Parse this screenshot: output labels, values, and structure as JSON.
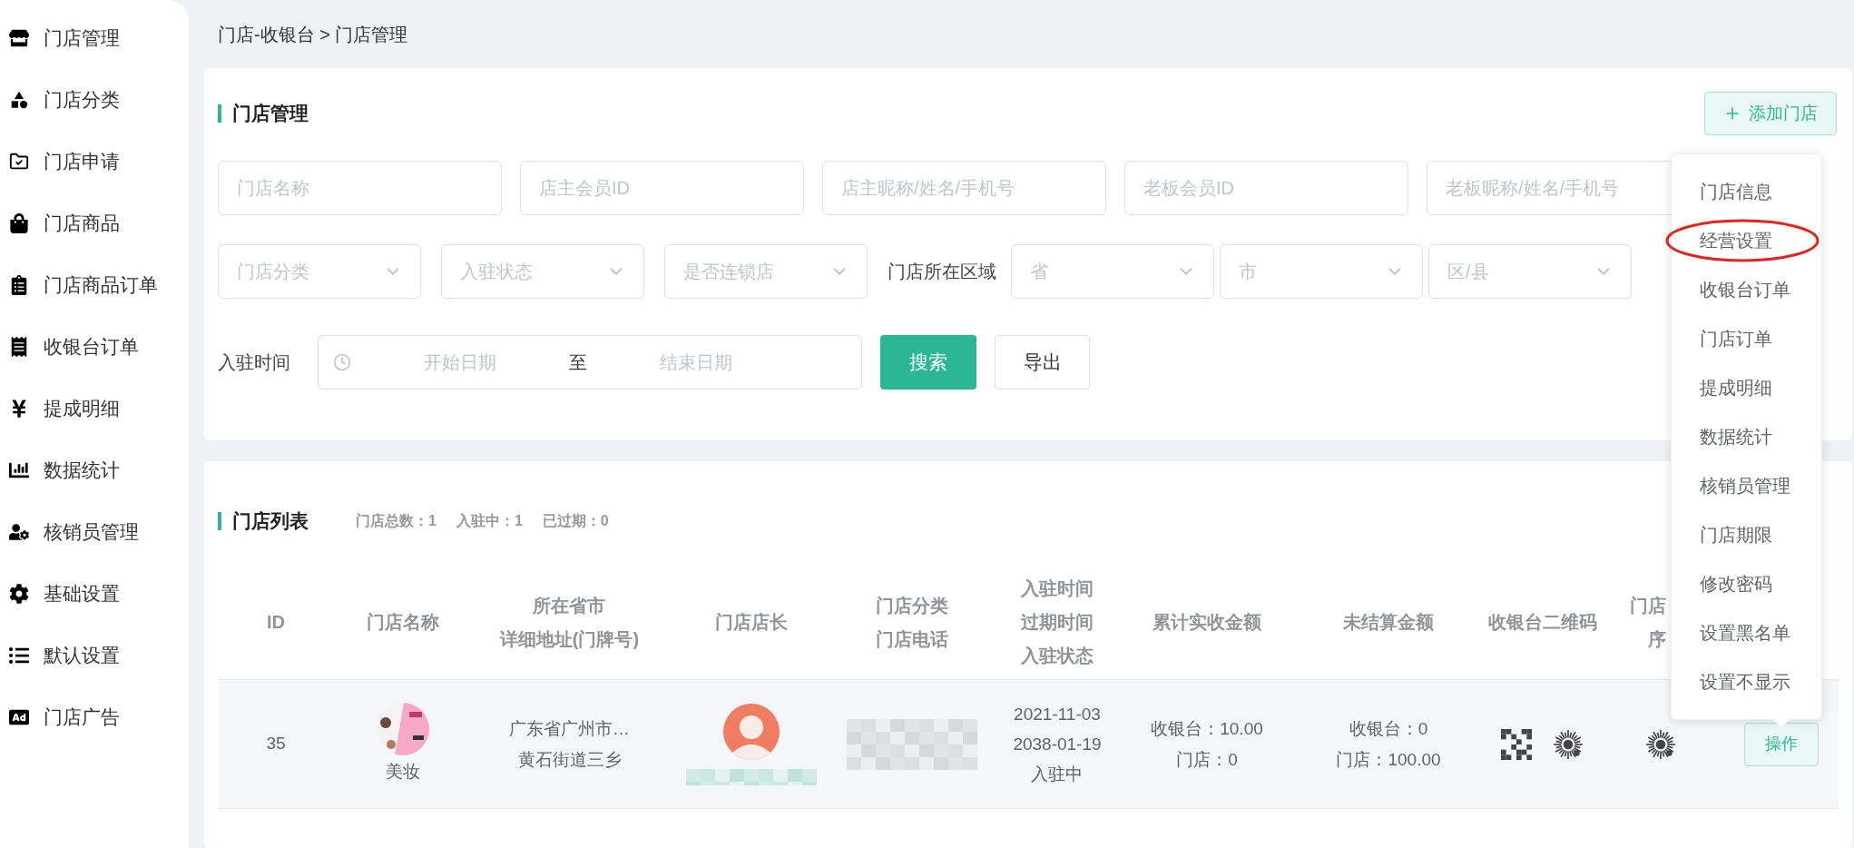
{
  "sidebar": {
    "items": [
      {
        "label": "门店管理"
      },
      {
        "label": "门店分类"
      },
      {
        "label": "门店申请"
      },
      {
        "label": "门店商品"
      },
      {
        "label": "门店商品订单"
      },
      {
        "label": "收银台订单"
      },
      {
        "label": "提成明细"
      },
      {
        "label": "数据统计"
      },
      {
        "label": "核销员管理"
      },
      {
        "label": "基础设置"
      },
      {
        "label": "默认设置"
      },
      {
        "label": "门店广告"
      }
    ]
  },
  "breadcrumb": "门店-收银台 > 门店管理",
  "filter_panel": {
    "title": "门店管理",
    "add_button": "添加门店",
    "text_fields": [
      {
        "placeholder": "门店名称"
      },
      {
        "placeholder": "店主会员ID"
      },
      {
        "placeholder": "店主昵称/姓名/手机号"
      },
      {
        "placeholder": "老板会员ID"
      },
      {
        "placeholder": "老板昵称/姓名/手机号"
      }
    ],
    "selects": [
      {
        "placeholder": "门店分类"
      },
      {
        "placeholder": "入驻状态"
      },
      {
        "placeholder": "是否连锁店"
      }
    ],
    "region_label": "门店所在区域",
    "region_selects": [
      {
        "placeholder": "省"
      },
      {
        "placeholder": "市"
      },
      {
        "placeholder": "区/县"
      }
    ],
    "date_label": "入驻时间",
    "date_range": {
      "start_placeholder": "开始日期",
      "separator": "至",
      "end_placeholder": "结束日期"
    },
    "search_button": "搜索",
    "export_button": "导出"
  },
  "store_list": {
    "title": "门店列表",
    "stats": [
      "门店总数：1",
      "入驻中：1",
      "已过期：0"
    ],
    "columns": [
      {
        "lines": [
          "ID"
        ]
      },
      {
        "lines": [
          "门店名称"
        ]
      },
      {
        "lines": [
          "所在省市",
          "详细地址(门牌号)"
        ]
      },
      {
        "lines": [
          "门店店长"
        ]
      },
      {
        "lines": [
          "门店分类",
          "门店电话"
        ]
      },
      {
        "lines": [
          "入驻时间",
          "过期时间",
          "入驻状态"
        ]
      },
      {
        "lines": [
          "累计实收金额"
        ]
      },
      {
        "lines": [
          "未结算金额"
        ]
      },
      {
        "lines": [
          "收银台二维码"
        ]
      },
      {
        "lines": [
          "门店",
          "序"
        ]
      },
      {}
    ],
    "rows": [
      {
        "id": "35",
        "name": "美妆",
        "address": [
          "广东省广州市…",
          "黄石街道三乡"
        ],
        "dates": [
          "2021-11-03",
          "2038-01-19",
          "入驻中"
        ],
        "total": [
          "收银台：10.00",
          "门店：0"
        ],
        "unsettled": [
          "收银台：0",
          "门店：100.00"
        ],
        "action": "操作"
      }
    ]
  },
  "action_menu": {
    "items": [
      {
        "label": "门店信息",
        "circled": false
      },
      {
        "label": "经营设置",
        "circled": true
      },
      {
        "label": "收银台订单",
        "circled": false
      },
      {
        "label": "门店订单",
        "circled": false
      },
      {
        "label": "提成明细",
        "circled": false
      },
      {
        "label": "数据统计",
        "circled": false
      },
      {
        "label": "核销员管理",
        "circled": false
      },
      {
        "label": "门店期限",
        "circled": false
      },
      {
        "label": "修改密码",
        "circled": false
      },
      {
        "label": "设置黑名单",
        "circled": false
      },
      {
        "label": "设置不显示",
        "circled": false
      }
    ]
  }
}
